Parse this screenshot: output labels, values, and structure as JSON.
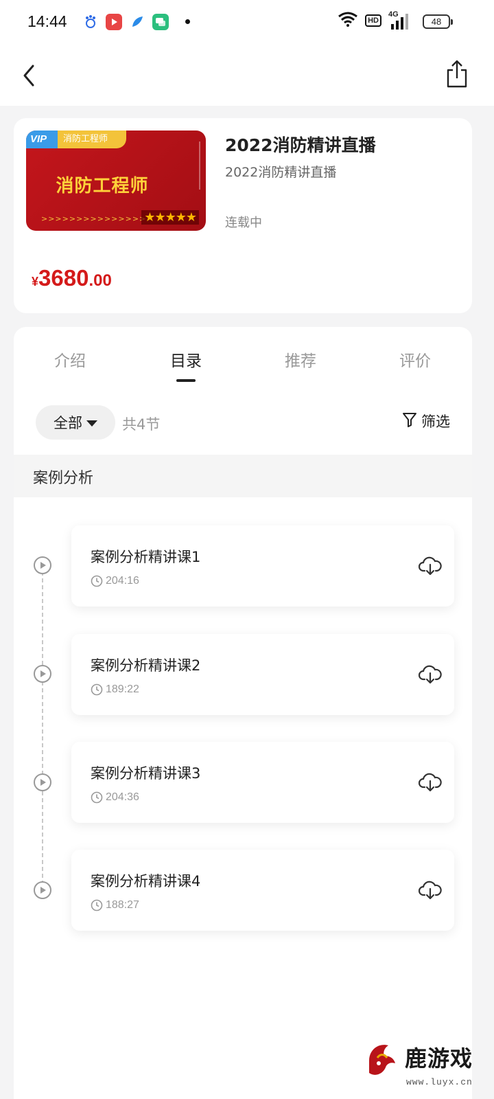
{
  "status_bar": {
    "time": "14:44",
    "network": "4G",
    "hd": "HD",
    "battery": "48"
  },
  "nav": {
    "back_icon": "chevron-left-icon",
    "share_icon": "share-icon"
  },
  "course": {
    "cover": {
      "vip": "VIP",
      "tagline": "消防工程师",
      "headline": "消防工程师",
      "rating_stars": 5
    },
    "title": "2022消防精讲直播",
    "subtitle": "2022消防精讲直播",
    "serial_status": "连载中",
    "price": {
      "currency": "¥",
      "integer": "3680",
      "decimal": ".00",
      "color": "#d41a1a"
    }
  },
  "tabs": [
    {
      "label": "介绍"
    },
    {
      "label": "目录"
    },
    {
      "label": "推荐"
    },
    {
      "label": "评价"
    }
  ],
  "active_tab": "目录",
  "filter_bar": {
    "scope_label": "全部",
    "count_label": "共4节",
    "filter_label": "筛选"
  },
  "section": {
    "title": "案例分析"
  },
  "lessons": [
    {
      "name": "案例分析精讲课1",
      "duration": "204:16"
    },
    {
      "name": "案例分析精讲课2",
      "duration": "189:22"
    },
    {
      "name": "案例分析精讲课3",
      "duration": "204:36"
    },
    {
      "name": "案例分析精讲课4",
      "duration": "188:27"
    }
  ],
  "watermark": {
    "brand": "鹿游戏",
    "url": "www.luyx.cn"
  }
}
